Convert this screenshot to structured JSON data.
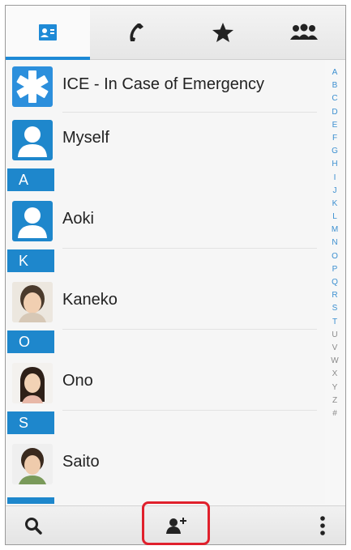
{
  "tabs": [
    {
      "name": "contacts",
      "icon": "contact-card-icon",
      "active": true
    },
    {
      "name": "call-log",
      "icon": "phone-handset-icon",
      "active": false
    },
    {
      "name": "favorites",
      "icon": "star-icon",
      "active": false
    },
    {
      "name": "groups",
      "icon": "group-icon",
      "active": false
    }
  ],
  "contacts": {
    "ice": {
      "label": "ICE - In Case of Emergency",
      "icon": "star-of-life-icon"
    },
    "myself": {
      "label": "Myself"
    },
    "sections": [
      {
        "letter": "A",
        "entries": [
          "Aoki"
        ]
      },
      {
        "letter": "K",
        "entries": [
          "Kaneko"
        ]
      },
      {
        "letter": "O",
        "entries": [
          "Ono"
        ]
      },
      {
        "letter": "S",
        "entries": [
          "Saito"
        ]
      }
    ]
  },
  "alphabet_index": [
    "A",
    "B",
    "C",
    "D",
    "E",
    "F",
    "G",
    "H",
    "I",
    "J",
    "K",
    "L",
    "M",
    "N",
    "O",
    "P",
    "Q",
    "R",
    "S",
    "T",
    "U",
    "V",
    "W",
    "X",
    "Y",
    "Z",
    "#"
  ],
  "bottom_bar": {
    "search_icon": "search-icon",
    "add_contact_icon": "add-contact-icon",
    "menu_icon": "overflow-menu-icon"
  },
  "colors": {
    "accent": "#1e87cc",
    "highlight": "#e0202c"
  }
}
